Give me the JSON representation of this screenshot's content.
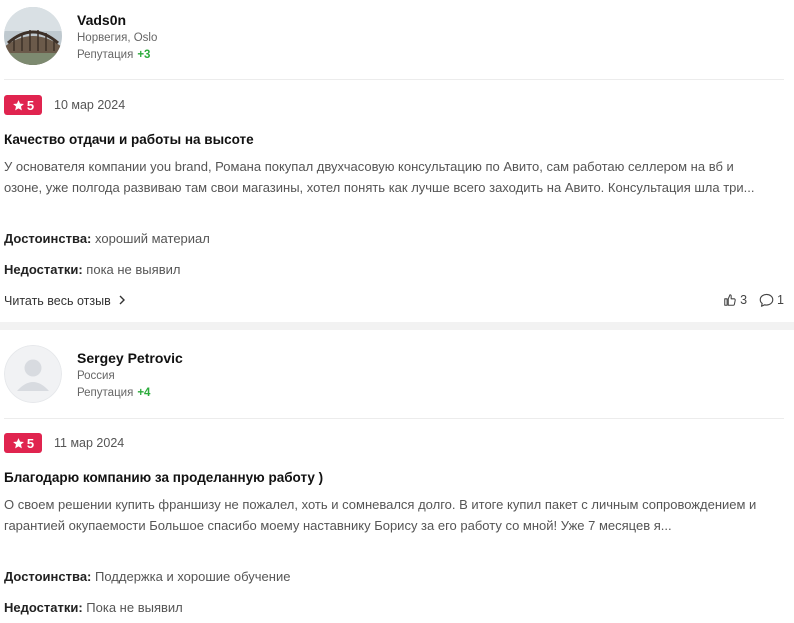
{
  "reviews": [
    {
      "user": {
        "name": "Vads0n",
        "location": "Норвегия, Oslo",
        "reputation_label": "Репутация",
        "reputation": "+3"
      },
      "rating": "5",
      "date": "10 мар 2024",
      "title": "Качество отдачи и работы на высоте",
      "text": "У основателя компании you brand, Романа покупал двухчасовую консультацию по Авито, сам работаю селлером на вб и озоне, уже полгода развиваю там свои магазины, хотел понять как лучше всего заходить на Авито. Консультация шла три...",
      "pros_label": "Достоинства:",
      "pros": "хороший материал",
      "cons_label": "Недостатки:",
      "cons": "пока не выявил",
      "read_more": "Читать весь отзыв",
      "likes": "3",
      "comments": "1"
    },
    {
      "user": {
        "name": "Sergey Petrovic",
        "location": "Россия",
        "reputation_label": "Репутация",
        "reputation": "+4"
      },
      "rating": "5",
      "date": "11 мар 2024",
      "title": "Благодарю компанию за проделанную работу )",
      "text": "О своем решении купить франшизу не пожалел, хоть и сомневался долго. В итоге купил пакет с личным сопровождением и гарантией окупаемости Большое спасибо моему наставнику Борису за его работу со мной! Уже 7 месяцев я...",
      "pros_label": "Достоинства:",
      "pros": "Поддержка и хорошие обучение",
      "cons_label": "Недостатки:",
      "cons": "Пока не выявил"
    }
  ],
  "icons": {
    "star": "star-icon",
    "chevron": "chevron-right-icon",
    "like": "thumbs-up-icon",
    "comment": "comment-icon"
  },
  "colors": {
    "rating_badge": "#e0244f",
    "reputation": "#2bab3b"
  }
}
